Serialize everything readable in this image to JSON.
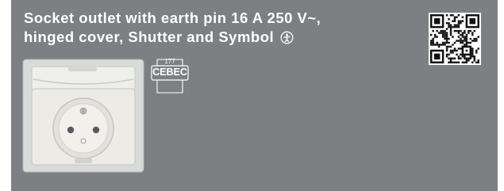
{
  "product": {
    "title_line1": "Socket outlet with earth pin 16 A 250 V~,",
    "title_line2": "hinged cover, Shutter and Symbol",
    "symbol_icon": "child-protection-symbol-icon",
    "image_icon": "socket-outlet-hinged-cover-icon"
  },
  "certification": {
    "number": "177",
    "mark": "CEBEC"
  },
  "qr_icon": "qr-code-icon",
  "colors": {
    "panel": "#7e7f83",
    "title_text": "#ffffff"
  }
}
